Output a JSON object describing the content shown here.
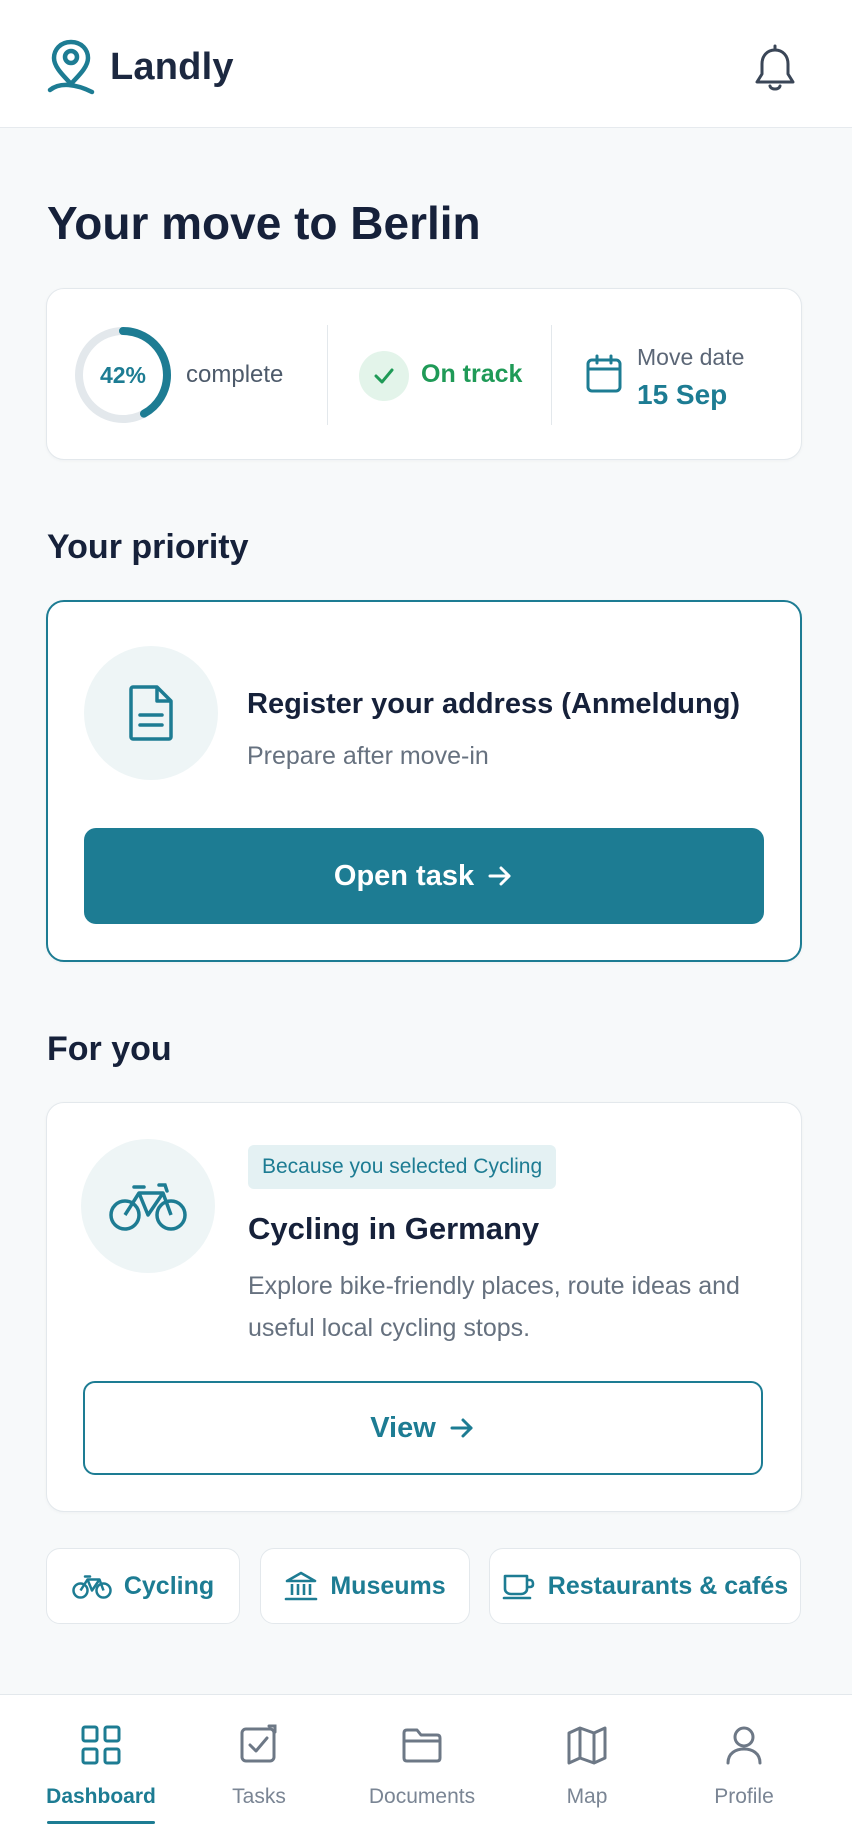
{
  "app": {
    "name": "Landly"
  },
  "page": {
    "title": "Your move to Berlin"
  },
  "status": {
    "progress_percent": 42,
    "progress_label": "42%",
    "complete_label": "complete",
    "track_label": "On track",
    "move_date_label": "Move date",
    "move_date_value": "15 Sep"
  },
  "priority": {
    "section_title": "Your priority",
    "task_title": "Register your address (Anmeldung)",
    "task_sub": "Prepare after move-in",
    "button_label": "Open task"
  },
  "foryou": {
    "section_title": "For you",
    "badge": "Because you selected Cycling",
    "title": "Cycling in Germany",
    "description": "Explore bike-friendly places, route ideas and useful local cycling stops.",
    "button_label": "View"
  },
  "chips": [
    {
      "label": "Cycling",
      "icon": "bicycle-icon"
    },
    {
      "label": "Museums",
      "icon": "museum-icon"
    },
    {
      "label": "Restaurants & cafés",
      "icon": "coffee-cup-icon"
    }
  ],
  "nav": {
    "items": [
      {
        "label": "Dashboard",
        "icon": "dashboard-grid-icon",
        "active": true
      },
      {
        "label": "Tasks",
        "icon": "task-check-icon",
        "active": false
      },
      {
        "label": "Documents",
        "icon": "folder-icon",
        "active": false
      },
      {
        "label": "Map",
        "icon": "map-icon",
        "active": false
      },
      {
        "label": "Profile",
        "icon": "user-icon",
        "active": false
      }
    ]
  },
  "colors": {
    "accent": "#1d7c93",
    "success": "#1f9a57",
    "text": "#16213a",
    "muted": "#66717f",
    "background": "#f7f9fa"
  }
}
